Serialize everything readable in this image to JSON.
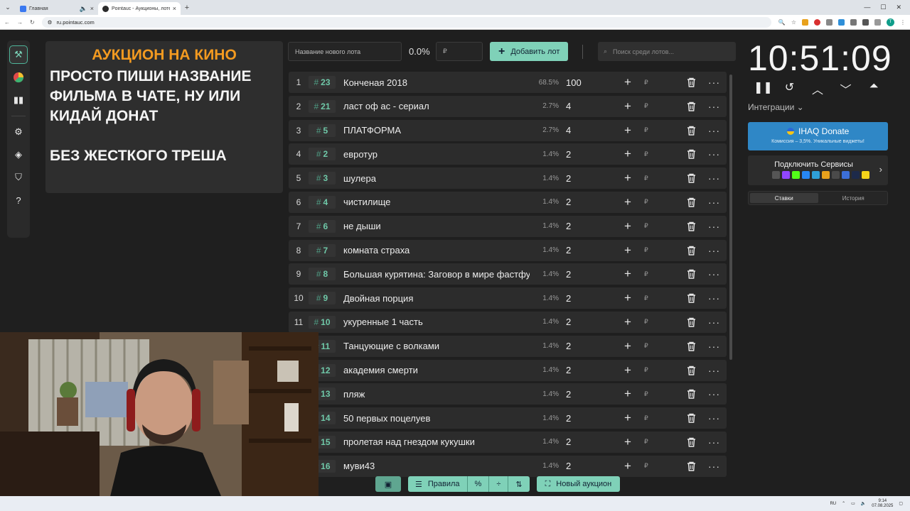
{
  "browser": {
    "tabs": [
      {
        "title": "Главная",
        "favicon_color": "#3a78f0"
      },
      {
        "title": "Pointauc - Аукционы, лотере",
        "favicon_color": "#2a2a2a"
      }
    ],
    "url": "ru.pointauc.com"
  },
  "banner": {
    "title": "АУКЦИОН НА КИНО",
    "text": "ПРОСТО ПИШИ НАЗВАНИЕ\nФИЛЬМА В ЧАТЕ, НУ ИЛИ\nКИДАЙ ДОНАТ\n\nБЕЗ ЖЕСТКОГО ТРЕША"
  },
  "toolbar": {
    "new_lot_placeholder": "Название нового лота",
    "percent": "0.0%",
    "currency": "₽",
    "add_lot_label": "Добавить лот",
    "search_placeholder": "Поиск среди лотов..."
  },
  "lots": [
    {
      "idx": "1",
      "id": "23",
      "name": "Конченая 2018",
      "pct": "68.5%",
      "amount": "100"
    },
    {
      "idx": "2",
      "id": "21",
      "name": "ласт оф ас - сериал",
      "pct": "2.7%",
      "amount": "4"
    },
    {
      "idx": "3",
      "id": "5",
      "name": "ПЛАТФОРМА",
      "pct": "2.7%",
      "amount": "4"
    },
    {
      "idx": "4",
      "id": "2",
      "name": " евротур",
      "pct": "1.4%",
      "amount": "2"
    },
    {
      "idx": "5",
      "id": "3",
      "name": "шулера",
      "pct": "1.4%",
      "amount": "2"
    },
    {
      "idx": "6",
      "id": "4",
      "name": "чистилище",
      "pct": "1.4%",
      "amount": "2"
    },
    {
      "idx": "7",
      "id": "6",
      "name": "не дыши",
      "pct": "1.4%",
      "amount": "2"
    },
    {
      "idx": "8",
      "id": "7",
      "name": "комната страха",
      "pct": "1.4%",
      "amount": "2"
    },
    {
      "idx": "9",
      "id": "8",
      "name": "Большая курятина: Заговор в мире фастфуда",
      "pct": "1.4%",
      "amount": "2"
    },
    {
      "idx": "10",
      "id": "9",
      "name": "Двойная порция",
      "pct": "1.4%",
      "amount": "2"
    },
    {
      "idx": "11",
      "id": "10",
      "name": " укуренные 1 часть",
      "pct": "1.4%",
      "amount": "2"
    },
    {
      "idx": "",
      "id": "11",
      "name": " Танцующие с волками",
      "pct": "1.4%",
      "amount": "2"
    },
    {
      "idx": "",
      "id": "12",
      "name": "академия смерти",
      "pct": "1.4%",
      "amount": "2"
    },
    {
      "idx": "",
      "id": "13",
      "name": " пляж",
      "pct": "1.4%",
      "amount": "2"
    },
    {
      "idx": "",
      "id": "14",
      "name": "50 первых поцелуев",
      "pct": "1.4%",
      "amount": "2"
    },
    {
      "idx": "",
      "id": "15",
      "name": "пролетая над гнездом кукушки",
      "pct": "1.4%",
      "amount": "2"
    },
    {
      "idx": "",
      "id": "16",
      "name": "муви43",
      "pct": "1.4%",
      "amount": "2"
    }
  ],
  "timer": {
    "time": "10:51:09"
  },
  "integrations": {
    "label": "Интеграции",
    "donate_title": "IHAQ Donate",
    "donate_sub": "Комиссия – 3,5%. Уникальные виджеты!",
    "services_label": "Подключить Сервисы",
    "tabs": [
      "Ставки",
      "История"
    ]
  },
  "bottom": {
    "rules_label": "Правила",
    "new_auction_label": "Новый аукцион"
  },
  "taskbar": {
    "lang": "RU",
    "time": "9:14",
    "date": "07.08.2025"
  }
}
